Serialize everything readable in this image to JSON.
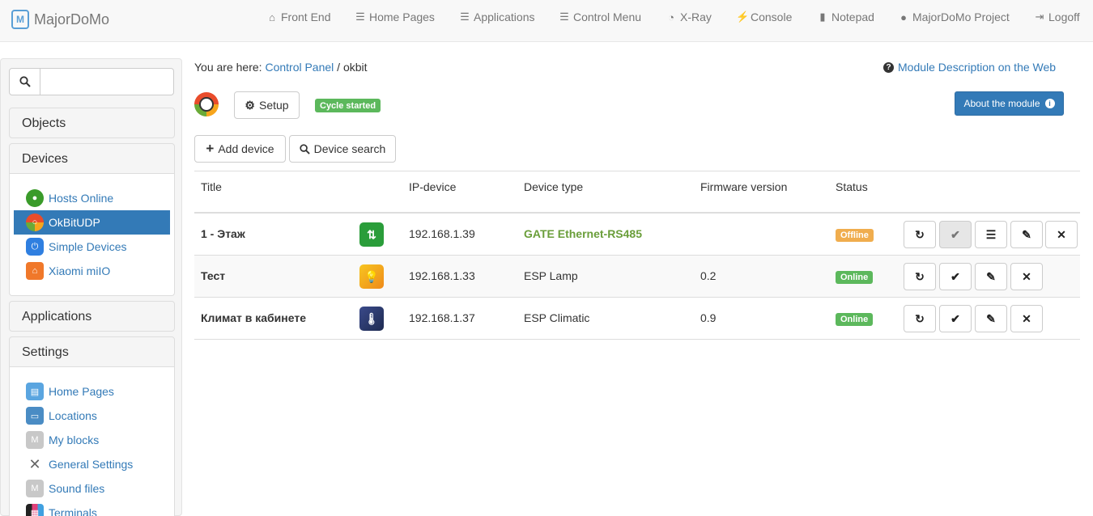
{
  "brand": {
    "name": "MajorDoMo",
    "logo_letter": "M"
  },
  "nav": [
    {
      "label": "Front End",
      "icon": "home-icon",
      "glyph": "⌂"
    },
    {
      "label": "Home Pages",
      "icon": "th-list-icon",
      "glyph": "☰"
    },
    {
      "label": "Applications",
      "icon": "th-list-icon",
      "glyph": "☰"
    },
    {
      "label": "Control Menu",
      "icon": "th-list-icon",
      "glyph": "☰"
    },
    {
      "label": "X-Ray",
      "icon": "dashboard-icon",
      "glyph": "◔"
    },
    {
      "label": "Console",
      "icon": "flash-icon",
      "glyph": "⚡"
    },
    {
      "label": "Notepad",
      "icon": "book-icon",
      "glyph": "▮"
    },
    {
      "label": "MajorDoMo Project",
      "icon": "globe-icon",
      "glyph": "●"
    },
    {
      "label": "Logoff",
      "icon": "log-out-icon",
      "glyph": "⇥"
    }
  ],
  "sidebar": {
    "search": {
      "placeholder": "",
      "value": ""
    },
    "panels": {
      "objects": "Objects",
      "devices": "Devices",
      "applications": "Applications",
      "settings": "Settings"
    },
    "devices_items": [
      {
        "label": "Hosts Online",
        "active": false
      },
      {
        "label": "OkBitUDP",
        "active": true
      },
      {
        "label": "Simple Devices",
        "active": false
      },
      {
        "label": "Xiaomi miIO",
        "active": false
      }
    ],
    "settings_items": [
      {
        "label": "Home Pages"
      },
      {
        "label": "Locations"
      },
      {
        "label": "My blocks"
      },
      {
        "label": "General Settings"
      },
      {
        "label": "Sound files"
      },
      {
        "label": "Terminals"
      }
    ]
  },
  "breadcrumb": {
    "prefix": "You are here:",
    "root": "Control Panel",
    "sep": "/",
    "current": "okbit"
  },
  "module_desc_link": "Module Description on the Web",
  "setup_button": "Setup",
  "cycle_label": "Cycle started",
  "about_button": "About the module",
  "add_device_button": "Add device",
  "device_search_button": "Device search",
  "table": {
    "headers": [
      "Title",
      "IP-device",
      "Device type",
      "Firmware version",
      "Status"
    ],
    "rows": [
      {
        "title": "1 - Этаж",
        "ip": "192.168.1.39",
        "type": "GATE Ethernet-RS485",
        "firmware": "",
        "status": "Offline",
        "status_color": "#f0ad4e",
        "icon": "gate-router-icon",
        "icon_color": "#2a9d3a"
      },
      {
        "title": "Тест",
        "ip": "192.168.1.33",
        "type": "ESP Lamp",
        "firmware": "0.2",
        "status": "Online",
        "status_color": "#5cb85c",
        "icon": "lamp-icon",
        "icon_color": "#f0a020"
      },
      {
        "title": "Климат в кабинете",
        "ip": "192.168.1.37",
        "type": "ESP Climatic",
        "firmware": "0.9",
        "status": "Online",
        "status_color": "#5cb85c",
        "icon": "thermometer-icon",
        "icon_color": "#2c3e70"
      }
    ]
  },
  "colors": {
    "link": "#337ab7",
    "active": "#337ab7",
    "gate_text": "#6a9e3a"
  }
}
